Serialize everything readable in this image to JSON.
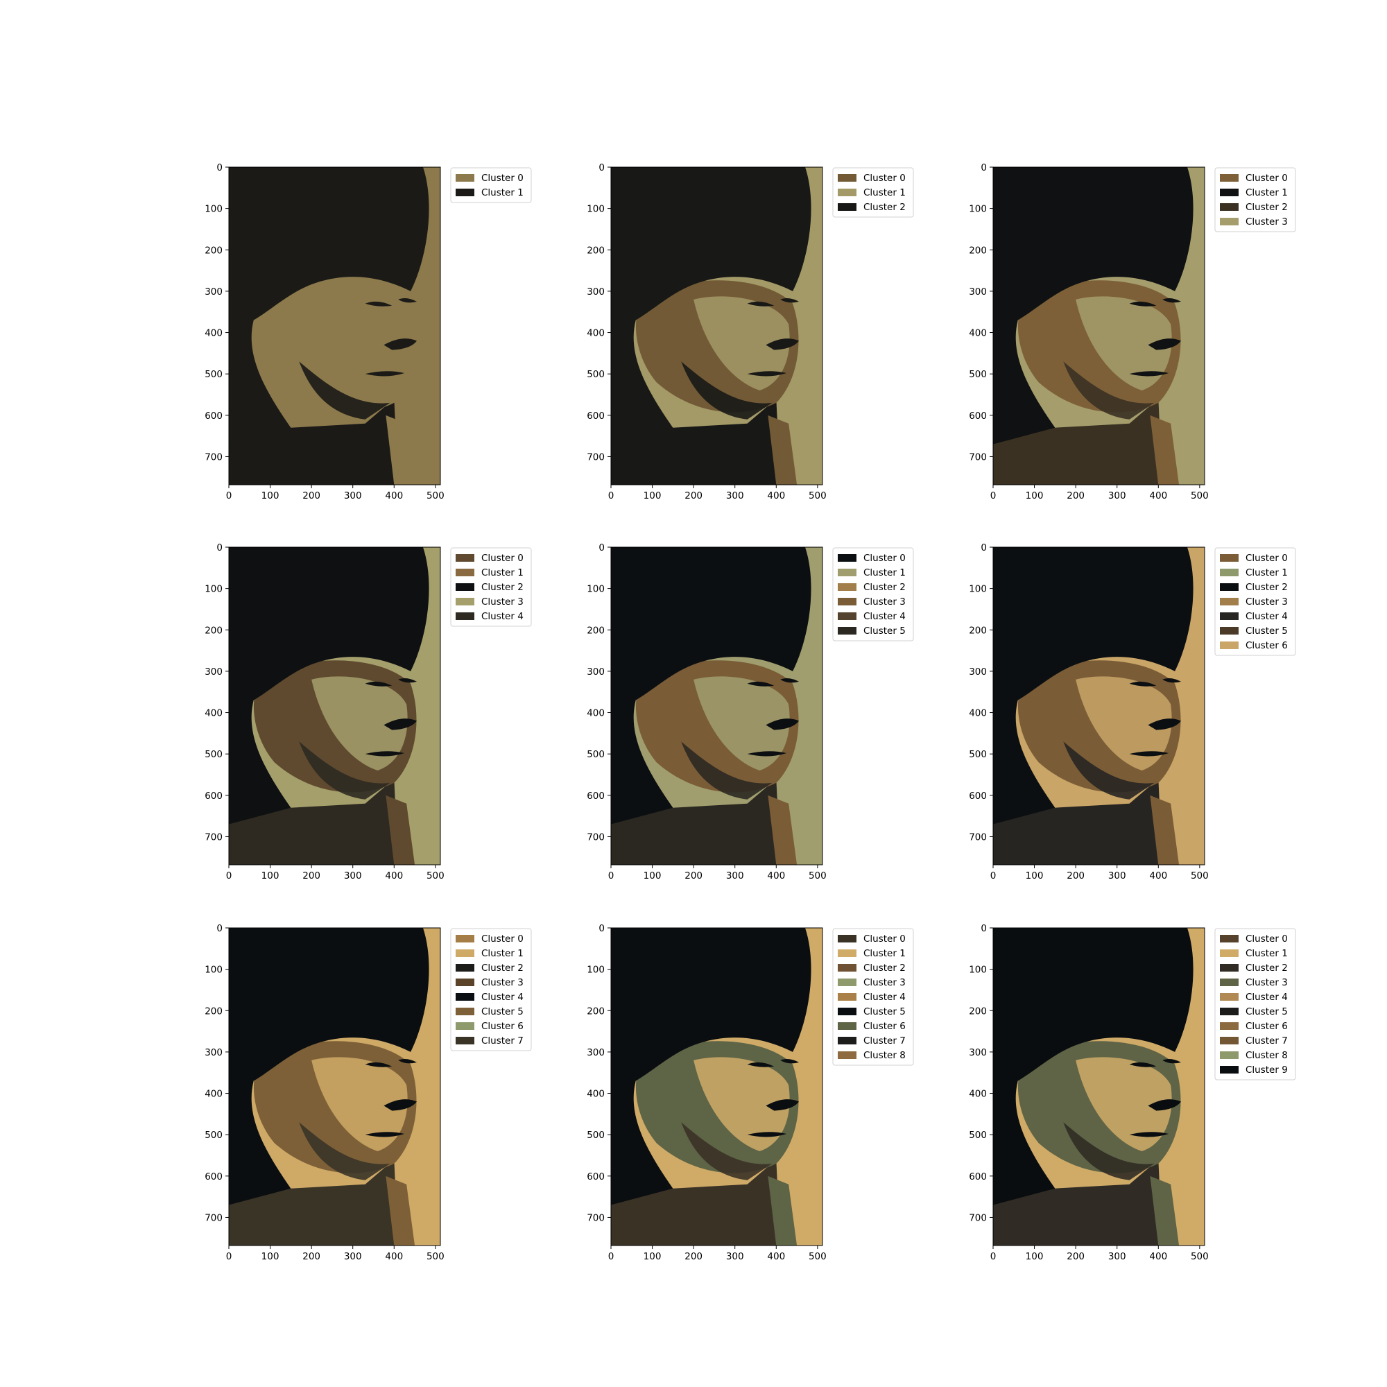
{
  "chart_data": [
    {
      "type": "image",
      "xlim": [
        0,
        512
      ],
      "ylim": [
        768,
        0
      ],
      "xticks": [
        0,
        100,
        200,
        300,
        400,
        500
      ],
      "yticks": [
        0,
        100,
        200,
        300,
        400,
        500,
        600,
        700
      ],
      "legend_position": "outside-right-top",
      "legend": [
        {
          "label": "Cluster 0",
          "color": "#8c7a4c"
        },
        {
          "label": "Cluster 1",
          "color": "#1b1a17"
        }
      ]
    },
    {
      "type": "image",
      "xlim": [
        0,
        512
      ],
      "ylim": [
        768,
        0
      ],
      "xticks": [
        0,
        100,
        200,
        300,
        400,
        500
      ],
      "yticks": [
        0,
        100,
        200,
        300,
        400,
        500,
        600,
        700
      ],
      "legend_position": "outside-right-top",
      "legend": [
        {
          "label": "Cluster 0",
          "color": "#725a36"
        },
        {
          "label": "Cluster 1",
          "color": "#a39a67"
        },
        {
          "label": "Cluster 2",
          "color": "#181816"
        }
      ]
    },
    {
      "type": "image",
      "xlim": [
        0,
        512
      ],
      "ylim": [
        768,
        0
      ],
      "xticks": [
        0,
        100,
        200,
        300,
        400,
        500
      ],
      "yticks": [
        0,
        100,
        200,
        300,
        400,
        500,
        600,
        700
      ],
      "legend_position": "outside-right-top",
      "legend": [
        {
          "label": "Cluster 0",
          "color": "#7d6038"
        },
        {
          "label": "Cluster 1",
          "color": "#0f1112"
        },
        {
          "label": "Cluster 2",
          "color": "#3b3123"
        },
        {
          "label": "Cluster 3",
          "color": "#a59d6c"
        }
      ]
    },
    {
      "type": "image",
      "xlim": [
        0,
        512
      ],
      "ylim": [
        768,
        0
      ],
      "xticks": [
        0,
        100,
        200,
        300,
        400,
        500
      ],
      "yticks": [
        0,
        100,
        200,
        300,
        400,
        500,
        600,
        700
      ],
      "legend_position": "outside-right-top",
      "legend": [
        {
          "label": "Cluster 0",
          "color": "#5f4a2f"
        },
        {
          "label": "Cluster 1",
          "color": "#8a6a40"
        },
        {
          "label": "Cluster 2",
          "color": "#0e1012"
        },
        {
          "label": "Cluster 3",
          "color": "#a59f6c"
        },
        {
          "label": "Cluster 4",
          "color": "#2e2a22"
        }
      ]
    },
    {
      "type": "image",
      "xlim": [
        0,
        512
      ],
      "ylim": [
        768,
        0
      ],
      "xticks": [
        0,
        100,
        200,
        300,
        400,
        500
      ],
      "yticks": [
        0,
        100,
        200,
        300,
        400,
        500,
        600,
        700
      ],
      "legend_position": "outside-right-top",
      "legend": [
        {
          "label": "Cluster 0",
          "color": "#0c0f12"
        },
        {
          "label": "Cluster 1",
          "color": "#a09e6e"
        },
        {
          "label": "Cluster 2",
          "color": "#a17e4a"
        },
        {
          "label": "Cluster 3",
          "color": "#7a5c37"
        },
        {
          "label": "Cluster 4",
          "color": "#54432e"
        },
        {
          "label": "Cluster 5",
          "color": "#2b2822"
        }
      ]
    },
    {
      "type": "image",
      "xlim": [
        0,
        512
      ],
      "ylim": [
        768,
        0
      ],
      "xticks": [
        0,
        100,
        200,
        300,
        400,
        500
      ],
      "yticks": [
        0,
        100,
        200,
        300,
        400,
        500,
        600,
        700
      ],
      "legend_position": "outside-right-top",
      "legend": [
        {
          "label": "Cluster 0",
          "color": "#7a5c37"
        },
        {
          "label": "Cluster 1",
          "color": "#8f9a6c"
        },
        {
          "label": "Cluster 2",
          "color": "#0c0f12"
        },
        {
          "label": "Cluster 3",
          "color": "#a17e4a"
        },
        {
          "label": "Cluster 4",
          "color": "#272522"
        },
        {
          "label": "Cluster 5",
          "color": "#4b3a28"
        },
        {
          "label": "Cluster 6",
          "color": "#c9a567"
        }
      ]
    },
    {
      "type": "image",
      "xlim": [
        0,
        512
      ],
      "ylim": [
        768,
        0
      ],
      "xticks": [
        0,
        100,
        200,
        300,
        400,
        500
      ],
      "yticks": [
        0,
        100,
        200,
        300,
        400,
        500,
        600,
        700
      ],
      "legend_position": "outside-right-top",
      "legend": [
        {
          "label": "Cluster 0",
          "color": "#a57d47"
        },
        {
          "label": "Cluster 1",
          "color": "#cfaa67"
        },
        {
          "label": "Cluster 2",
          "color": "#1c1c1a"
        },
        {
          "label": "Cluster 3",
          "color": "#5a4329"
        },
        {
          "label": "Cluster 4",
          "color": "#0b0e11"
        },
        {
          "label": "Cluster 5",
          "color": "#7d6038"
        },
        {
          "label": "Cluster 6",
          "color": "#8f9a6c"
        },
        {
          "label": "Cluster 7",
          "color": "#3a3427"
        }
      ]
    },
    {
      "type": "image",
      "xlim": [
        0,
        512
      ],
      "ylim": [
        768,
        0
      ],
      "xticks": [
        0,
        100,
        200,
        300,
        400,
        500
      ],
      "yticks": [
        0,
        100,
        200,
        300,
        400,
        500,
        600,
        700
      ],
      "legend_position": "outside-right-top",
      "legend": [
        {
          "label": "Cluster 0",
          "color": "#3b3226"
        },
        {
          "label": "Cluster 1",
          "color": "#d0ab68"
        },
        {
          "label": "Cluster 2",
          "color": "#6e5233"
        },
        {
          "label": "Cluster 3",
          "color": "#8f9a6c"
        },
        {
          "label": "Cluster 4",
          "color": "#a98048"
        },
        {
          "label": "Cluster 5",
          "color": "#0b0e11"
        },
        {
          "label": "Cluster 6",
          "color": "#5e6446"
        },
        {
          "label": "Cluster 7",
          "color": "#1d1d1c"
        },
        {
          "label": "Cluster 8",
          "color": "#8d6a40"
        }
      ]
    },
    {
      "type": "image",
      "xlim": [
        0,
        512
      ],
      "ylim": [
        768,
        0
      ],
      "xticks": [
        0,
        100,
        200,
        300,
        400,
        500
      ],
      "yticks": [
        0,
        100,
        200,
        300,
        400,
        500,
        600,
        700
      ],
      "legend_position": "outside-right-top",
      "legend": [
        {
          "label": "Cluster 0",
          "color": "#56422c"
        },
        {
          "label": "Cluster 1",
          "color": "#d0ab68"
        },
        {
          "label": "Cluster 2",
          "color": "#302b24"
        },
        {
          "label": "Cluster 3",
          "color": "#5f6446"
        },
        {
          "label": "Cluster 4",
          "color": "#b08a52"
        },
        {
          "label": "Cluster 5",
          "color": "#1c1c1b"
        },
        {
          "label": "Cluster 6",
          "color": "#8c6a40"
        },
        {
          "label": "Cluster 7",
          "color": "#735634"
        },
        {
          "label": "Cluster 8",
          "color": "#8f9a6c"
        },
        {
          "label": "Cluster 9",
          "color": "#0a0d10"
        }
      ]
    }
  ]
}
